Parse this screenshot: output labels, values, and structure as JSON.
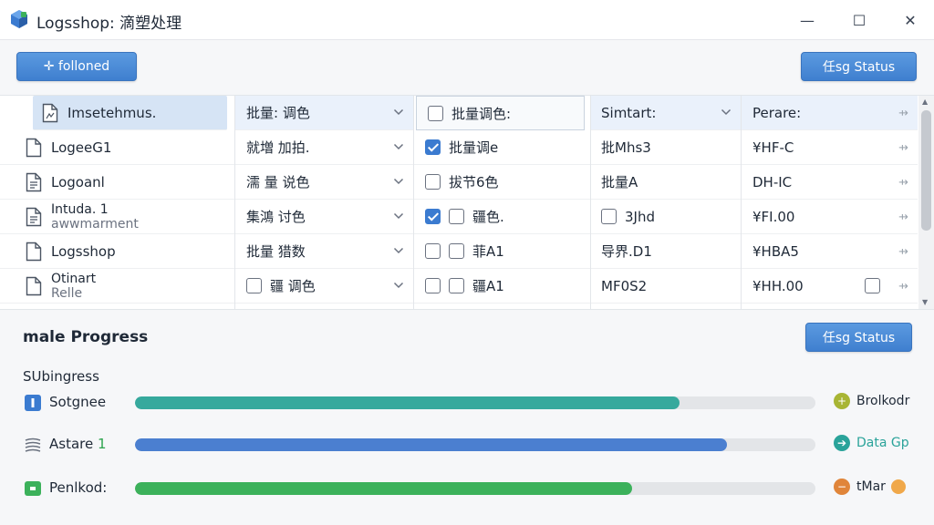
{
  "window": {
    "title": "Logsshop: 滴塑处理",
    "minimize_glyph": "—",
    "maximize_glyph": "☐",
    "close_glyph": "✕",
    "accent_color": "#3f7fcf"
  },
  "toolbar": {
    "add_button": "✛ folloned",
    "status_button": "任sg Status"
  },
  "grid": {
    "files": [
      {
        "label": "Imsetehmus.",
        "line2": "",
        "icon": "file-image-icon",
        "selected": true
      },
      {
        "label": "LogeeG1",
        "line2": "",
        "icon": "file-icon"
      },
      {
        "label": "Logoanl",
        "line2": "",
        "icon": "file-text-icon"
      },
      {
        "label": "Intuda. 1",
        "line2": "awwmarment",
        "icon": "file-text-icon"
      },
      {
        "label": "Logsshop",
        "line2": "",
        "icon": "file-icon"
      },
      {
        "label": "Otinart",
        "line2": "Relle",
        "icon": "file-icon"
      }
    ],
    "col2": [
      {
        "label": "批量: 调色",
        "checkbox": false
      },
      {
        "label": "就増 加拍.",
        "checkbox": false
      },
      {
        "label": "濡 量 说色",
        "checkbox": false
      },
      {
        "label": "集鴻 讨色",
        "checkbox": false
      },
      {
        "label": "批量 猎数",
        "checkbox": false
      },
      {
        "label": "疆 调色",
        "checkbox": true
      }
    ],
    "col3": [
      {
        "label": "批量调色:",
        "boxes": [
          false
        ]
      },
      {
        "label": "批量调e",
        "boxes": [
          true
        ]
      },
      {
        "label": "拔节6色",
        "boxes": [
          false
        ]
      },
      {
        "label": "疆色.",
        "boxes": [
          true,
          false
        ]
      },
      {
        "label": "菲A1",
        "boxes": [
          false,
          false
        ]
      },
      {
        "label": "疆A1",
        "boxes": [
          false,
          false
        ]
      }
    ],
    "col4": [
      {
        "label": "Simtart:",
        "checkbox": false
      },
      {
        "label": "批Mhs3",
        "checkbox": false
      },
      {
        "label": "批量A",
        "checkbox": false
      },
      {
        "label": "3Jhd",
        "checkbox": true
      },
      {
        "label": "导界.D1",
        "checkbox": false
      },
      {
        "label": "MF0S2",
        "checkbox": false
      }
    ],
    "col5": [
      {
        "label": "Perare:"
      },
      {
        "label": "¥HF-C"
      },
      {
        "label": "DH-IC"
      },
      {
        "label": "¥FI.00"
      },
      {
        "label": "¥HBA5"
      },
      {
        "label": "¥HH.00"
      }
    ],
    "pin_glyph": "⇸"
  },
  "progress": {
    "title": "male Progress",
    "status_button": "任sg Status",
    "subtitle": "SUbingress",
    "rows": [
      {
        "label": "Sotgnee",
        "accent": "",
        "value": 0.8,
        "color": "#36a99d",
        "icon": "info-icon",
        "right_label": "Brolkodr",
        "right_color": "#a8b534",
        "right_glyph": "+",
        "right_icon": "plus-circle-icon"
      },
      {
        "label": "Astare",
        "accent": "1",
        "value": 0.87,
        "color": "#4b7fd0",
        "icon": "stack-icon",
        "right_label": "Data Gp",
        "right_color": "#2aa39a",
        "right_glyph": "➔",
        "right_icon": "arrow-circle-icon"
      },
      {
        "label": "Penlkod:",
        "accent": "",
        "value": 0.73,
        "color": "#3cb15b",
        "icon": "green-tag-icon",
        "right_label": "tMar",
        "right_color": "#e0853a",
        "right_glyph": "−",
        "right_icon": "minus-circle-icon"
      }
    ]
  }
}
